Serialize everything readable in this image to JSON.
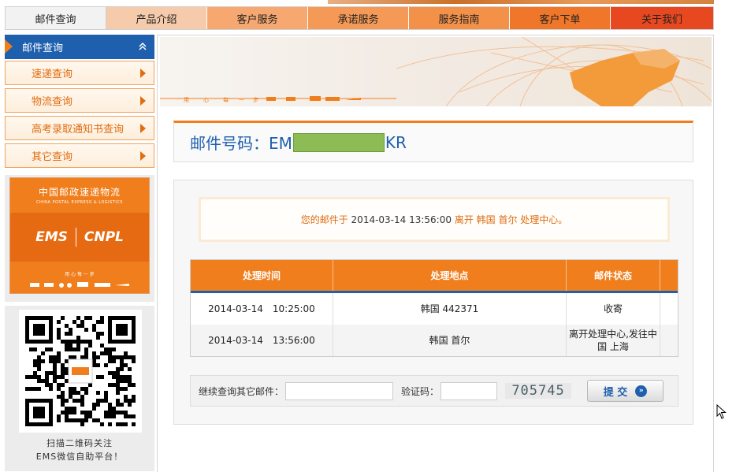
{
  "nav": {
    "tabs": [
      {
        "label": "邮件查询",
        "color": "#f2f2f2"
      },
      {
        "label": "产品介绍",
        "color": "#f6cbab"
      },
      {
        "label": "客户服务",
        "color": "#f7a871"
      },
      {
        "label": "承诺服务",
        "color": "#f59a56"
      },
      {
        "label": "服务指南",
        "color": "#f39149"
      },
      {
        "label": "客户下单",
        "color": "#f0772a"
      },
      {
        "label": "关于我们",
        "color": "#e8481f"
      }
    ]
  },
  "sidebar": {
    "heading": "邮件查询",
    "items": [
      {
        "label": "速递查询"
      },
      {
        "label": "物流查询"
      },
      {
        "label": "高考录取通知书查询"
      },
      {
        "label": "其它查询"
      }
    ],
    "ems_logo": {
      "cn": "中国邮政速递物流",
      "en": "CHINA POSTAL EXPRESS & LOGISTICS",
      "ems": "EMS",
      "cnpl": "CNPL",
      "slogan": "用 心 每 一 步"
    },
    "qr_caption_1": "扫描二维码关注",
    "qr_caption_2": "EMS微信自助平台！"
  },
  "main": {
    "title_prefix": "邮件号码：EM",
    "title_suffix": "KR",
    "notice_prefix": "您的邮件于",
    "notice_date": "2014-03-14 13:56:00",
    "notice_suffix": "离开 韩国 首尔 处理中心。",
    "table": {
      "headers": [
        "处理时间",
        "处理地点",
        "邮件状态"
      ],
      "rows": [
        {
          "time": "2014-03-14　10:25:00",
          "place": "韩国 442371",
          "status": "收寄"
        },
        {
          "time": "2014-03-14　13:56:00",
          "place": "韩国 首尔",
          "status": "离开处理中心,发往中国 上海"
        }
      ]
    },
    "form": {
      "continue_label": "继续查询其它邮件：",
      "captcha_label": "验证码：",
      "captcha_text": "705745",
      "submit_label": "提 交"
    }
  },
  "colors": {
    "accent_orange": "#f07e1c",
    "accent_blue": "#1e5fae"
  }
}
